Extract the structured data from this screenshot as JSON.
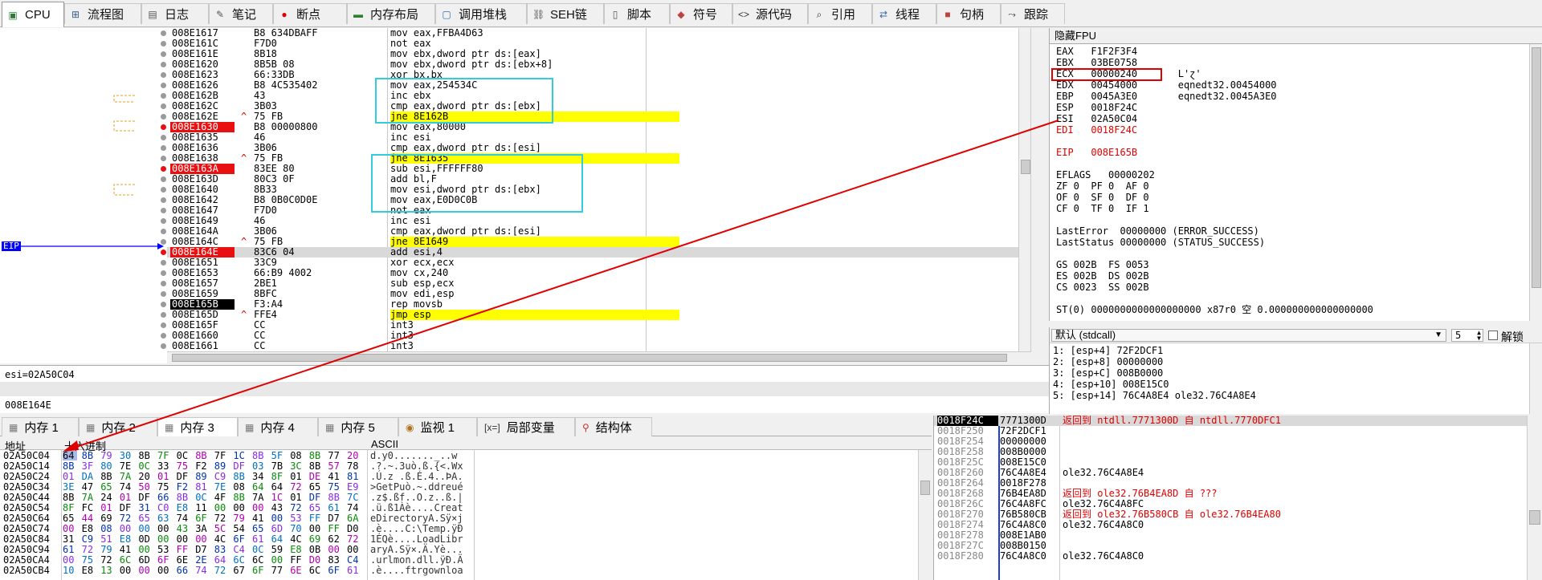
{
  "tabs": [
    {
      "label": "CPU",
      "icon": "cpu-icon",
      "glyph": "▣",
      "color": "#2e7d32"
    },
    {
      "label": "流程图",
      "icon": "flowchart-icon",
      "glyph": "⊞",
      "color": "#3a5a8a"
    },
    {
      "label": "日志",
      "icon": "log-icon",
      "glyph": "▤",
      "color": "#555"
    },
    {
      "label": "笔记",
      "icon": "notes-icon",
      "glyph": "✎",
      "color": "#555"
    },
    {
      "label": "断点",
      "icon": "breakpoint-icon",
      "glyph": "●",
      "color": "#d00"
    },
    {
      "label": "内存布局",
      "icon": "memory-map-icon",
      "glyph": "▬",
      "color": "#2e7d32"
    },
    {
      "label": "调用堆栈",
      "icon": "call-stack-icon",
      "glyph": "▢",
      "color": "#3a6ab0"
    },
    {
      "label": "SEH链",
      "icon": "seh-icon",
      "glyph": "⛓",
      "color": "#555"
    },
    {
      "label": "脚本",
      "icon": "script-icon",
      "glyph": "▯",
      "color": "#555"
    },
    {
      "label": "符号",
      "icon": "symbols-icon",
      "glyph": "◆",
      "color": "#c04040"
    },
    {
      "label": "源代码",
      "icon": "source-icon",
      "glyph": "<>",
      "color": "#333"
    },
    {
      "label": "引用",
      "icon": "references-icon",
      "glyph": "⌕",
      "color": "#333"
    },
    {
      "label": "线程",
      "icon": "threads-icon",
      "glyph": "⇄",
      "color": "#3a6ab0"
    },
    {
      "label": "句柄",
      "icon": "handles-icon",
      "glyph": "■",
      "color": "#c04040"
    },
    {
      "label": "跟踪",
      "icon": "trace-icon",
      "glyph": "⤳",
      "color": "#333"
    }
  ],
  "disasm": {
    "rows": [
      {
        "addr": "008E1617",
        "mark": "",
        "bytes": "B8 634DBAFF",
        "instr": "mov eax,FFBA4D63",
        "style": ""
      },
      {
        "addr": "008E161C",
        "mark": "",
        "bytes": "F7D0",
        "instr": "not eax",
        "style": ""
      },
      {
        "addr": "008E161E",
        "mark": "",
        "bytes": "8B18",
        "instr": "mov ebx,dword ptr ds:[eax]",
        "style": ""
      },
      {
        "addr": "008E1620",
        "mark": "",
        "bytes": "8B5B 08",
        "instr": "mov ebx,dword ptr ds:[ebx+8]",
        "style": ""
      },
      {
        "addr": "008E1623",
        "mark": "",
        "bytes": "66:33DB",
        "instr": "xor bx,bx",
        "style": ""
      },
      {
        "addr": "008E1626",
        "mark": "",
        "bytes": "B8 4C535402",
        "instr": "mov eax,254534C",
        "style": ""
      },
      {
        "addr": "008E162B",
        "mark": "",
        "bytes": "43",
        "instr": "inc ebx",
        "style": ""
      },
      {
        "addr": "008E162C",
        "mark": "",
        "bytes": "3B03",
        "instr": "cmp eax,dword ptr ds:[ebx]",
        "style": ""
      },
      {
        "addr": "008E162E",
        "mark": "^",
        "bytes": "75 FB",
        "instr": "jne 8E162B",
        "style": "jmp"
      },
      {
        "addr": "008E1630",
        "mark": "",
        "bytes": "B8 00000800",
        "instr": "mov eax,80000",
        "style": "bp"
      },
      {
        "addr": "008E1635",
        "mark": "",
        "bytes": "46",
        "instr": "inc esi",
        "style": ""
      },
      {
        "addr": "008E1636",
        "mark": "",
        "bytes": "3B06",
        "instr": "cmp eax,dword ptr ds:[esi]",
        "style": ""
      },
      {
        "addr": "008E1638",
        "mark": "^",
        "bytes": "75 FB",
        "instr": "jne 8E1635",
        "style": "jmp"
      },
      {
        "addr": "008E163A",
        "mark": "",
        "bytes": "83EE 80",
        "instr": "sub esi,FFFFFF80",
        "style": "bp"
      },
      {
        "addr": "008E163D",
        "mark": "",
        "bytes": "80C3 0F",
        "instr": "add bl,F",
        "style": ""
      },
      {
        "addr": "008E1640",
        "mark": "",
        "bytes": "8B33",
        "instr": "mov esi,dword ptr ds:[ebx]",
        "style": ""
      },
      {
        "addr": "008E1642",
        "mark": "",
        "bytes": "B8 0B0C0D0E",
        "instr": "mov eax,E0D0C0B",
        "style": ""
      },
      {
        "addr": "008E1647",
        "mark": "",
        "bytes": "F7D0",
        "instr": "not eax",
        "style": ""
      },
      {
        "addr": "008E1649",
        "mark": "",
        "bytes": "46",
        "instr": "inc esi",
        "style": ""
      },
      {
        "addr": "008E164A",
        "mark": "",
        "bytes": "3B06",
        "instr": "cmp eax,dword ptr ds:[esi]",
        "style": ""
      },
      {
        "addr": "008E164C",
        "mark": "^",
        "bytes": "75 FB",
        "instr": "jne 8E1649",
        "style": "jmp"
      },
      {
        "addr": "008E164E",
        "mark": "",
        "bytes": "83C6 04",
        "instr": "add esi,4",
        "style": "bp-hl"
      },
      {
        "addr": "008E1651",
        "mark": "",
        "bytes": "33C9",
        "instr": "xor ecx,ecx",
        "style": ""
      },
      {
        "addr": "008E1653",
        "mark": "",
        "bytes": "66:B9 4002",
        "instr": "mov cx,240",
        "style": ""
      },
      {
        "addr": "008E1657",
        "mark": "",
        "bytes": "2BE1",
        "instr": "sub esp,ecx",
        "style": ""
      },
      {
        "addr": "008E1659",
        "mark": "",
        "bytes": "8BFC",
        "instr": "mov edi,esp",
        "style": ""
      },
      {
        "addr": "008E165B",
        "mark": "",
        "bytes": "F3:A4",
        "instr": "rep movsb",
        "style": "eip"
      },
      {
        "addr": "008E165D",
        "mark": "^",
        "bytes": "FFE4",
        "instr": "jmp esp",
        "style": "jmp"
      },
      {
        "addr": "008E165F",
        "mark": "",
        "bytes": "CC",
        "instr": "int3",
        "style": ""
      },
      {
        "addr": "008E1660",
        "mark": "",
        "bytes": "CC",
        "instr": "int3",
        "style": ""
      },
      {
        "addr": "008E1661",
        "mark": "",
        "bytes": "CC",
        "instr": "int3",
        "style": ""
      }
    ],
    "eip_label": "EIP"
  },
  "info": {
    "line1": "esi=02A50C04",
    "line2": "008E164E"
  },
  "registers": {
    "title": "隐藏FPU",
    "lines": [
      {
        "text": "EAX   F1F2F3F4",
        "cls": ""
      },
      {
        "text": "EBX   03BE0758",
        "cls": ""
      },
      {
        "text": "ECX   00000240       L'ɀ'",
        "cls": ""
      },
      {
        "text": "EDX   00454000       eqnedt32.00454000",
        "cls": ""
      },
      {
        "text": "EBP   0045A3E0       eqnedt32.0045A3E0",
        "cls": ""
      },
      {
        "text": "ESP   0018F24C",
        "cls": ""
      },
      {
        "text": "ESI   02A50C04",
        "cls": ""
      },
      {
        "text": "EDI   0018F24C",
        "cls": "red"
      },
      {
        "text": "",
        "cls": ""
      },
      {
        "text": "EIP   008E165B",
        "cls": "red"
      },
      {
        "text": "",
        "cls": ""
      },
      {
        "text": "EFLAGS   00000202",
        "cls": ""
      },
      {
        "text": "ZF 0  PF 0  AF 0",
        "cls": ""
      },
      {
        "text": "OF 0  SF 0  DF 0",
        "cls": ""
      },
      {
        "text": "CF 0  TF 0  IF 1",
        "cls": ""
      },
      {
        "text": "",
        "cls": ""
      },
      {
        "text": "LastError  00000000 (ERROR_SUCCESS)",
        "cls": ""
      },
      {
        "text": "LastStatus 00000000 (STATUS_SUCCESS)",
        "cls": ""
      },
      {
        "text": "",
        "cls": ""
      },
      {
        "text": "GS 002B  FS 0053",
        "cls": ""
      },
      {
        "text": "ES 002B  DS 002B",
        "cls": ""
      },
      {
        "text": "CS 0023  SS 002B",
        "cls": ""
      },
      {
        "text": "",
        "cls": ""
      },
      {
        "text": "ST(0) 0000000000000000000 x87r0 空 0.000000000000000000",
        "cls": ""
      }
    ]
  },
  "callstack": {
    "convention": "默认 (stdcall)",
    "count": "5",
    "unlock_label": "解锁",
    "lines": [
      "1: [esp+4] 72F2DCF1",
      "2: [esp+8] 00000000",
      "3: [esp+C] 008B0000",
      "4: [esp+10] 008E15C0",
      "5: [esp+14] 76C4A8E4 ole32.76C4A8E4"
    ]
  },
  "bottom_tabs": [
    {
      "label": "内存 1",
      "icon": "memory-1-icon",
      "glyph": "▦",
      "color": "#777"
    },
    {
      "label": "内存 2",
      "icon": "memory-2-icon",
      "glyph": "▦",
      "color": "#777"
    },
    {
      "label": "内存 3",
      "icon": "memory-3-icon",
      "glyph": "▦",
      "color": "#777"
    },
    {
      "label": "内存 4",
      "icon": "memory-4-icon",
      "glyph": "▦",
      "color": "#777"
    },
    {
      "label": "内存 5",
      "icon": "memory-5-icon",
      "glyph": "▦",
      "color": "#777"
    },
    {
      "label": "监视 1",
      "icon": "watch-icon",
      "glyph": "◉",
      "color": "#b07020"
    },
    {
      "label": "局部变量",
      "icon": "locals-icon",
      "glyph": "[x=]",
      "color": "#333"
    },
    {
      "label": "结构体",
      "icon": "struct-icon",
      "glyph": "⚲",
      "color": "#c03030"
    }
  ],
  "dump": {
    "headers": {
      "addr": "地址",
      "hex": "十六进制",
      "ascii": "ASCII"
    },
    "rows": [
      {
        "addr": "02A50C04",
        "hex": [
          "64",
          "8B",
          "79",
          "30",
          "8B",
          "7F",
          "0C",
          "8B",
          "7F",
          "1C",
          "8B",
          "5F",
          "08",
          "8B",
          "77",
          "20"
        ],
        "ascii": "d.y0......._..w "
      },
      {
        "addr": "02A50C14",
        "hex": [
          "8B",
          "3F",
          "80",
          "7E",
          "0C",
          "33",
          "75",
          "F2",
          "89",
          "DF",
          "03",
          "7B",
          "3C",
          "8B",
          "57",
          "78"
        ],
        "ascii": ".?.~.3uò.ß.{<.Wx"
      },
      {
        "addr": "02A50C24",
        "hex": [
          "01",
          "DA",
          "8B",
          "7A",
          "20",
          "01",
          "DF",
          "89",
          "C9",
          "8B",
          "34",
          "8F",
          "01",
          "DE",
          "41",
          "81"
        ],
        "ascii": ".Ú.z .ß.É.4..ÞA."
      },
      {
        "addr": "02A50C34",
        "hex": [
          "3E",
          "47",
          "65",
          "74",
          "50",
          "75",
          "F2",
          "81",
          "7E",
          "08",
          "64",
          "64",
          "72",
          "65",
          "75",
          "E9"
        ],
        "ascii": ">GetPuò.~.ddreué"
      },
      {
        "addr": "02A50C44",
        "hex": [
          "8B",
          "7A",
          "24",
          "01",
          "DF",
          "66",
          "8B",
          "0C",
          "4F",
          "8B",
          "7A",
          "1C",
          "01",
          "DF",
          "8B",
          "7C"
        ],
        "ascii": ".z$.ßf..O.z..ß.|"
      },
      {
        "addr": "02A50C54",
        "hex": [
          "8F",
          "FC",
          "01",
          "DF",
          "31",
          "C0",
          "E8",
          "11",
          "00",
          "00",
          "00",
          "43",
          "72",
          "65",
          "61",
          "74"
        ],
        "ascii": ".ü.ß1Àè....Creat"
      },
      {
        "addr": "02A50C64",
        "hex": [
          "65",
          "44",
          "69",
          "72",
          "65",
          "63",
          "74",
          "6F",
          "72",
          "79",
          "41",
          "00",
          "53",
          "FF",
          "D7",
          "6A"
        ],
        "ascii": "eDirectoryA.Sÿ×j"
      },
      {
        "addr": "02A50C74",
        "hex": [
          "00",
          "E8",
          "08",
          "00",
          "00",
          "00",
          "43",
          "3A",
          "5C",
          "54",
          "65",
          "6D",
          "70",
          "00",
          "FF",
          "D0"
        ],
        "ascii": ".è....C:\\Temp.ÿÐ"
      },
      {
        "addr": "02A50C84",
        "hex": [
          "31",
          "C9",
          "51",
          "E8",
          "0D",
          "00",
          "00",
          "00",
          "4C",
          "6F",
          "61",
          "64",
          "4C",
          "69",
          "62",
          "72"
        ],
        "ascii": "1ÉQè....LoadLibr"
      },
      {
        "addr": "02A50C94",
        "hex": [
          "61",
          "72",
          "79",
          "41",
          "00",
          "53",
          "FF",
          "D7",
          "83",
          "C4",
          "0C",
          "59",
          "E8",
          "0B",
          "00",
          "00"
        ],
        "ascii": "aryA.Sÿ×.Ä.Yè..."
      },
      {
        "addr": "02A50CA4",
        "hex": [
          "00",
          "75",
          "72",
          "6C",
          "6D",
          "6F",
          "6E",
          "2E",
          "64",
          "6C",
          "6C",
          "00",
          "FF",
          "D0",
          "83",
          "C4"
        ],
        "ascii": ".urlmon.dll.ÿÐ.Ä"
      },
      {
        "addr": "02A50CB4",
        "hex": [
          "10",
          "E8",
          "13",
          "00",
          "00",
          "00",
          "66",
          "74",
          "72",
          "67",
          "6F",
          "77",
          "6E",
          "6C",
          "6F",
          "61"
        ],
        "ascii": ".è....ftrgownloa"
      }
    ]
  },
  "stack": {
    "rows": [
      {
        "addr": "0018F24C",
        "val": "7771300D",
        "cmt": "返回到 ntdll.7771300D 自 ntdll.7770DFC1",
        "red": true,
        "cur": true
      },
      {
        "addr": "0018F250",
        "val": "72F2DCF1",
        "cmt": "",
        "red": false,
        "cur": false
      },
      {
        "addr": "0018F254",
        "val": "00000000",
        "cmt": "",
        "red": false,
        "cur": false
      },
      {
        "addr": "0018F258",
        "val": "008B0000",
        "cmt": "",
        "red": false,
        "cur": false
      },
      {
        "addr": "0018F25C",
        "val": "008E15C0",
        "cmt": "",
        "red": false,
        "cur": false
      },
      {
        "addr": "0018F260",
        "val": "76C4A8E4",
        "cmt": "ole32.76C4A8E4",
        "red": false,
        "cur": false
      },
      {
        "addr": "0018F264",
        "val": "0018F278",
        "cmt": "",
        "red": false,
        "cur": false
      },
      {
        "addr": "0018F268",
        "val": "76B4EA8D",
        "cmt": "返回到 ole32.76B4EA8D 自 ???",
        "red": true,
        "cur": false
      },
      {
        "addr": "0018F26C",
        "val": "76C4A8FC",
        "cmt": "ole32.76C4A8FC",
        "red": false,
        "cur": false
      },
      {
        "addr": "0018F270",
        "val": "76B580CB",
        "cmt": "返回到 ole32.76B580CB 自 ole32.76B4EA80",
        "red": true,
        "cur": false
      },
      {
        "addr": "0018F274",
        "val": "76C4A8C0",
        "cmt": "ole32.76C4A8C0",
        "red": false,
        "cur": false
      },
      {
        "addr": "0018F278",
        "val": "008E1AB0",
        "cmt": "",
        "red": false,
        "cur": false
      },
      {
        "addr": "0018F27C",
        "val": "008B0150",
        "cmt": "",
        "red": false,
        "cur": false
      },
      {
        "addr": "0018F280",
        "val": "76C4A8C0",
        "cmt": "ole32.76C4A8C0",
        "red": false,
        "cur": false
      }
    ]
  },
  "colors": {
    "breakpoint": "#e81010",
    "eip_bg": "#000000",
    "jump_highlight": "#ffff00",
    "annotation_red": "#e00000",
    "annotation_cyan": "#33ccdd",
    "eip_arrow": "#0000ff"
  }
}
